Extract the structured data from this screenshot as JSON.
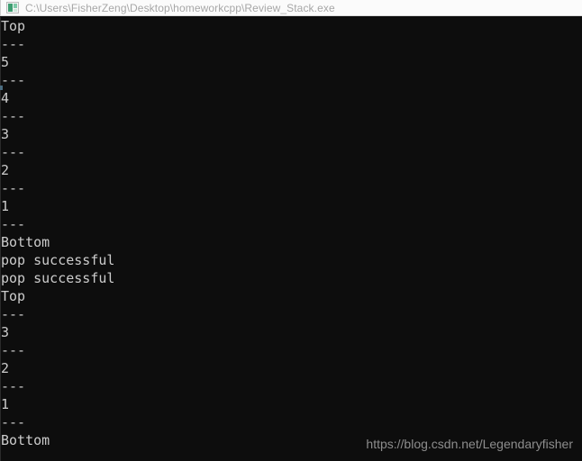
{
  "window": {
    "title": "C:\\Users\\FisherZeng\\Desktop\\homeworkcpp\\Review_Stack.exe",
    "icon": "console-app-icon",
    "background_color": "#0d0d0d",
    "titlebar_background_color": "#fbfbfb",
    "titlebar_text_color": "#a7a7a7"
  },
  "console": {
    "text_color": "#cccccc",
    "font_size_px": 15,
    "line_height_px": 20,
    "lines": [
      "Top",
      "---",
      "5",
      "---",
      "4",
      "---",
      "3",
      "---",
      "2",
      "---",
      "1",
      "---",
      "Bottom",
      "pop successful",
      "pop successful",
      "Top",
      "---",
      "3",
      "---",
      "2",
      "---",
      "1",
      "---",
      "Bottom"
    ]
  },
  "watermark": {
    "text": "https://blog.csdn.net/Legendaryfisher",
    "color": "#8d8d8d"
  }
}
